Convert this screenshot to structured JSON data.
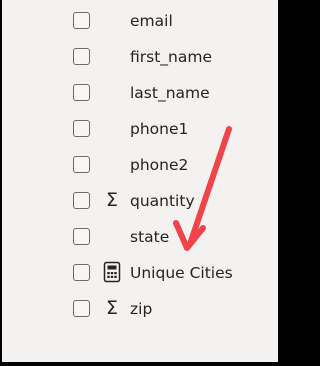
{
  "fields_pane": {
    "fields": [
      {
        "label": "email",
        "icon": ""
      },
      {
        "label": "first_name",
        "icon": ""
      },
      {
        "label": "last_name",
        "icon": ""
      },
      {
        "label": "phone1",
        "icon": ""
      },
      {
        "label": "phone2",
        "icon": ""
      },
      {
        "label": "quantity",
        "icon": "sigma-icon"
      },
      {
        "label": "state",
        "icon": ""
      },
      {
        "label": "Unique Cities",
        "icon": "calculator-icon"
      },
      {
        "label": "zip",
        "icon": "sigma-icon"
      }
    ],
    "sigma_glyph": "Σ"
  },
  "annotation": {
    "arrow_color": "#ef4449",
    "points_to": "Unique Cities"
  },
  "colors": {
    "panel_background": "#f4f2f0",
    "frame": "#000000",
    "text": "#252423"
  }
}
